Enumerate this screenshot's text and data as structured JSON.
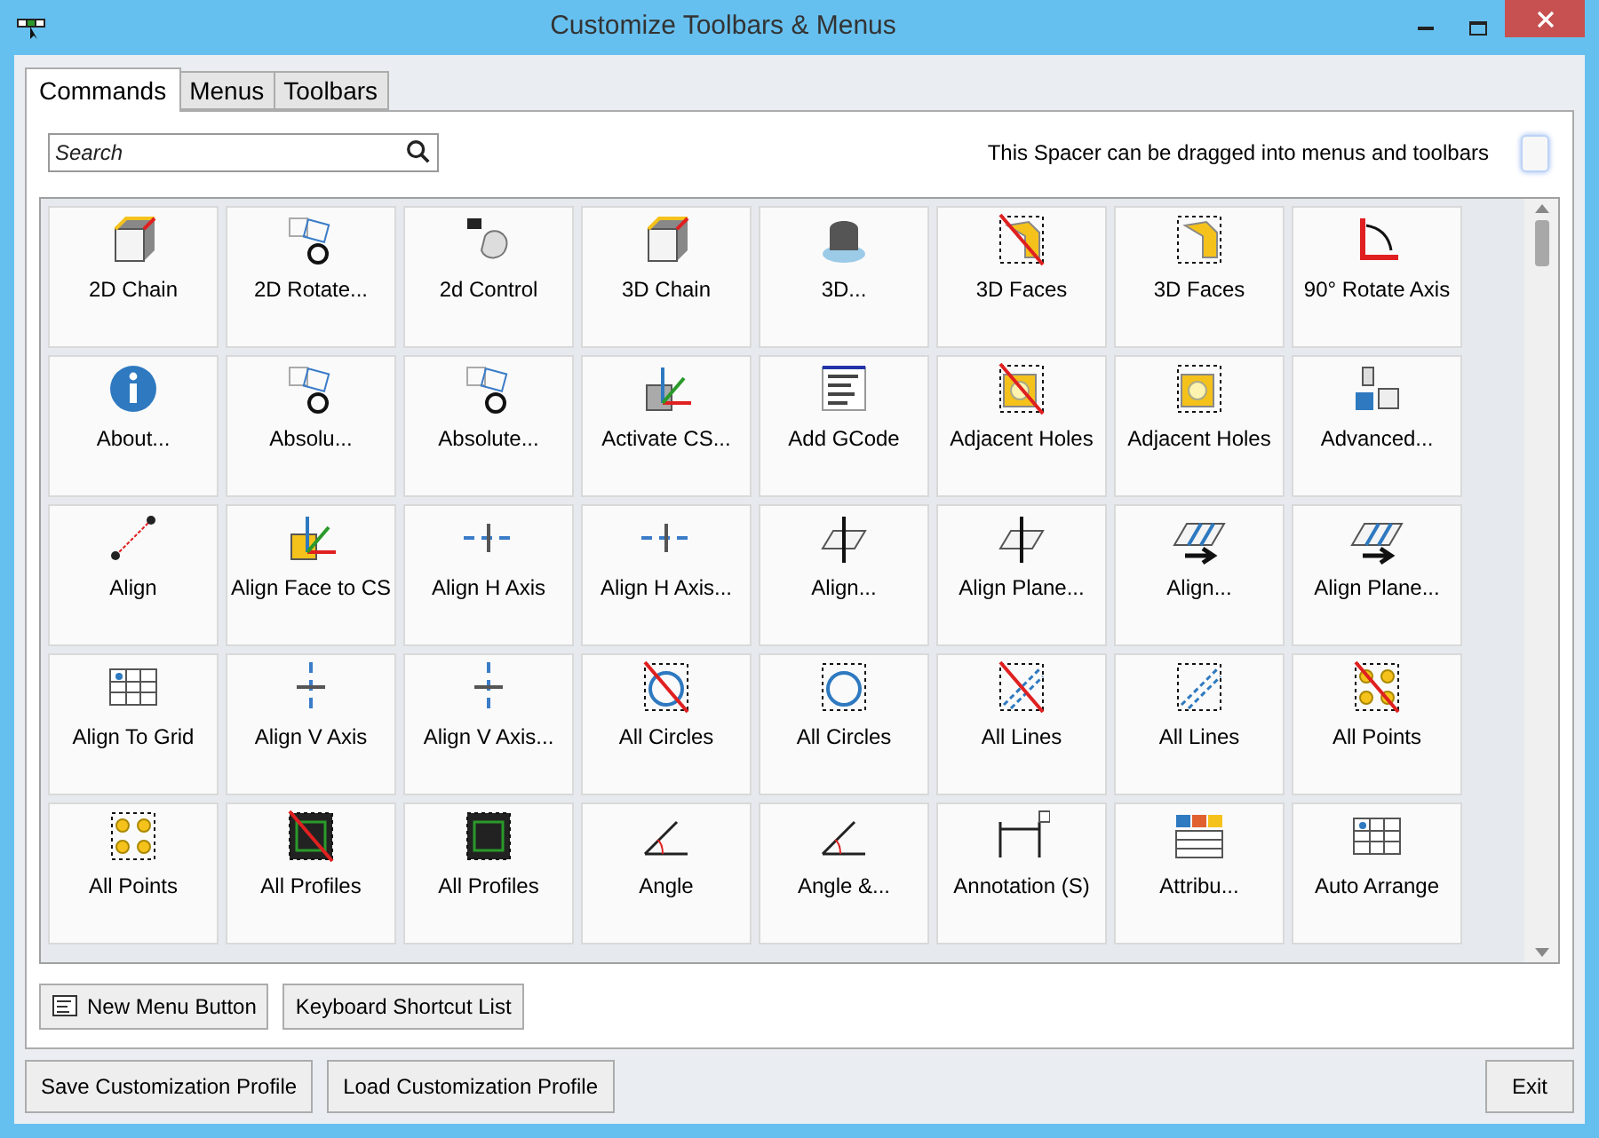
{
  "window": {
    "title": "Customize Toolbars & Menus"
  },
  "tabs": [
    {
      "label": "Commands",
      "selected": true
    },
    {
      "label": "Menus",
      "selected": false
    },
    {
      "label": "Toolbars",
      "selected": false
    }
  ],
  "search": {
    "placeholder": "Search"
  },
  "spacer_hint": "This Spacer can be dragged into menus and toolbars",
  "commands": [
    "2D Chain",
    "2D Rotate...",
    "2d Control",
    "3D Chain",
    "3D...",
    "3D Faces",
    "3D Faces",
    "90° Rotate Axis",
    "About...",
    "Absolu...",
    "Absolute...",
    "Activate CS...",
    "Add GCode",
    "Adjacent Holes",
    "Adjacent Holes",
    "Advanced...",
    "Align",
    "Align Face to CS",
    "Align H Axis",
    "Align H Axis...",
    "Align...",
    "Align Plane...",
    "Align...",
    "Align Plane...",
    "Align To Grid",
    "Align V Axis",
    "Align V Axis...",
    "All Circles",
    "All Circles",
    "All Lines",
    "All Lines",
    "All Points",
    "All Points",
    "All Profiles",
    "All Profiles",
    "Angle",
    "Angle &...",
    "Annotation (S)",
    "Attribu...",
    "Auto Arrange"
  ],
  "panel_buttons": [
    "New Menu Button",
    "Keyboard Shortcut List"
  ],
  "footer_buttons": [
    "Save Customization Profile",
    "Load Customization Profile",
    "Exit"
  ]
}
